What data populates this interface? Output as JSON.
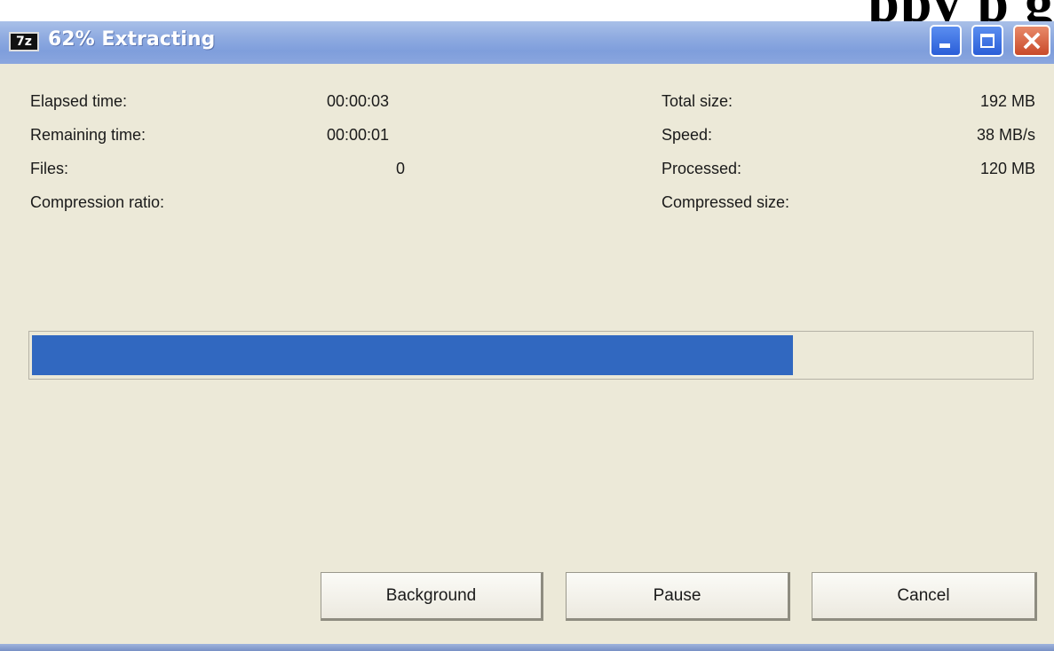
{
  "background_heading": "ppy p g",
  "window": {
    "title": "62% Extracting",
    "icon_text": "7z",
    "icon": "7zip-icon"
  },
  "stats": {
    "elapsed_label": "Elapsed time:",
    "elapsed_value": "00:00:03",
    "remaining_label": "Remaining time:",
    "remaining_value": "00:00:01",
    "files_label": "Files:",
    "files_value": "0",
    "ratio_label": "Compression ratio:",
    "total_label": "Total size:",
    "total_value": "192 MB",
    "speed_label": "Speed:",
    "speed_value": "38 MB/s",
    "processed_label": "Processed:",
    "processed_value": "120 MB",
    "compressed_label": "Compressed size:"
  },
  "progress": {
    "percent": 62,
    "fill_color": "#3168c0"
  },
  "buttons": {
    "background_label": "Background",
    "pause_label": "Pause",
    "cancel_label": "Cancel"
  }
}
